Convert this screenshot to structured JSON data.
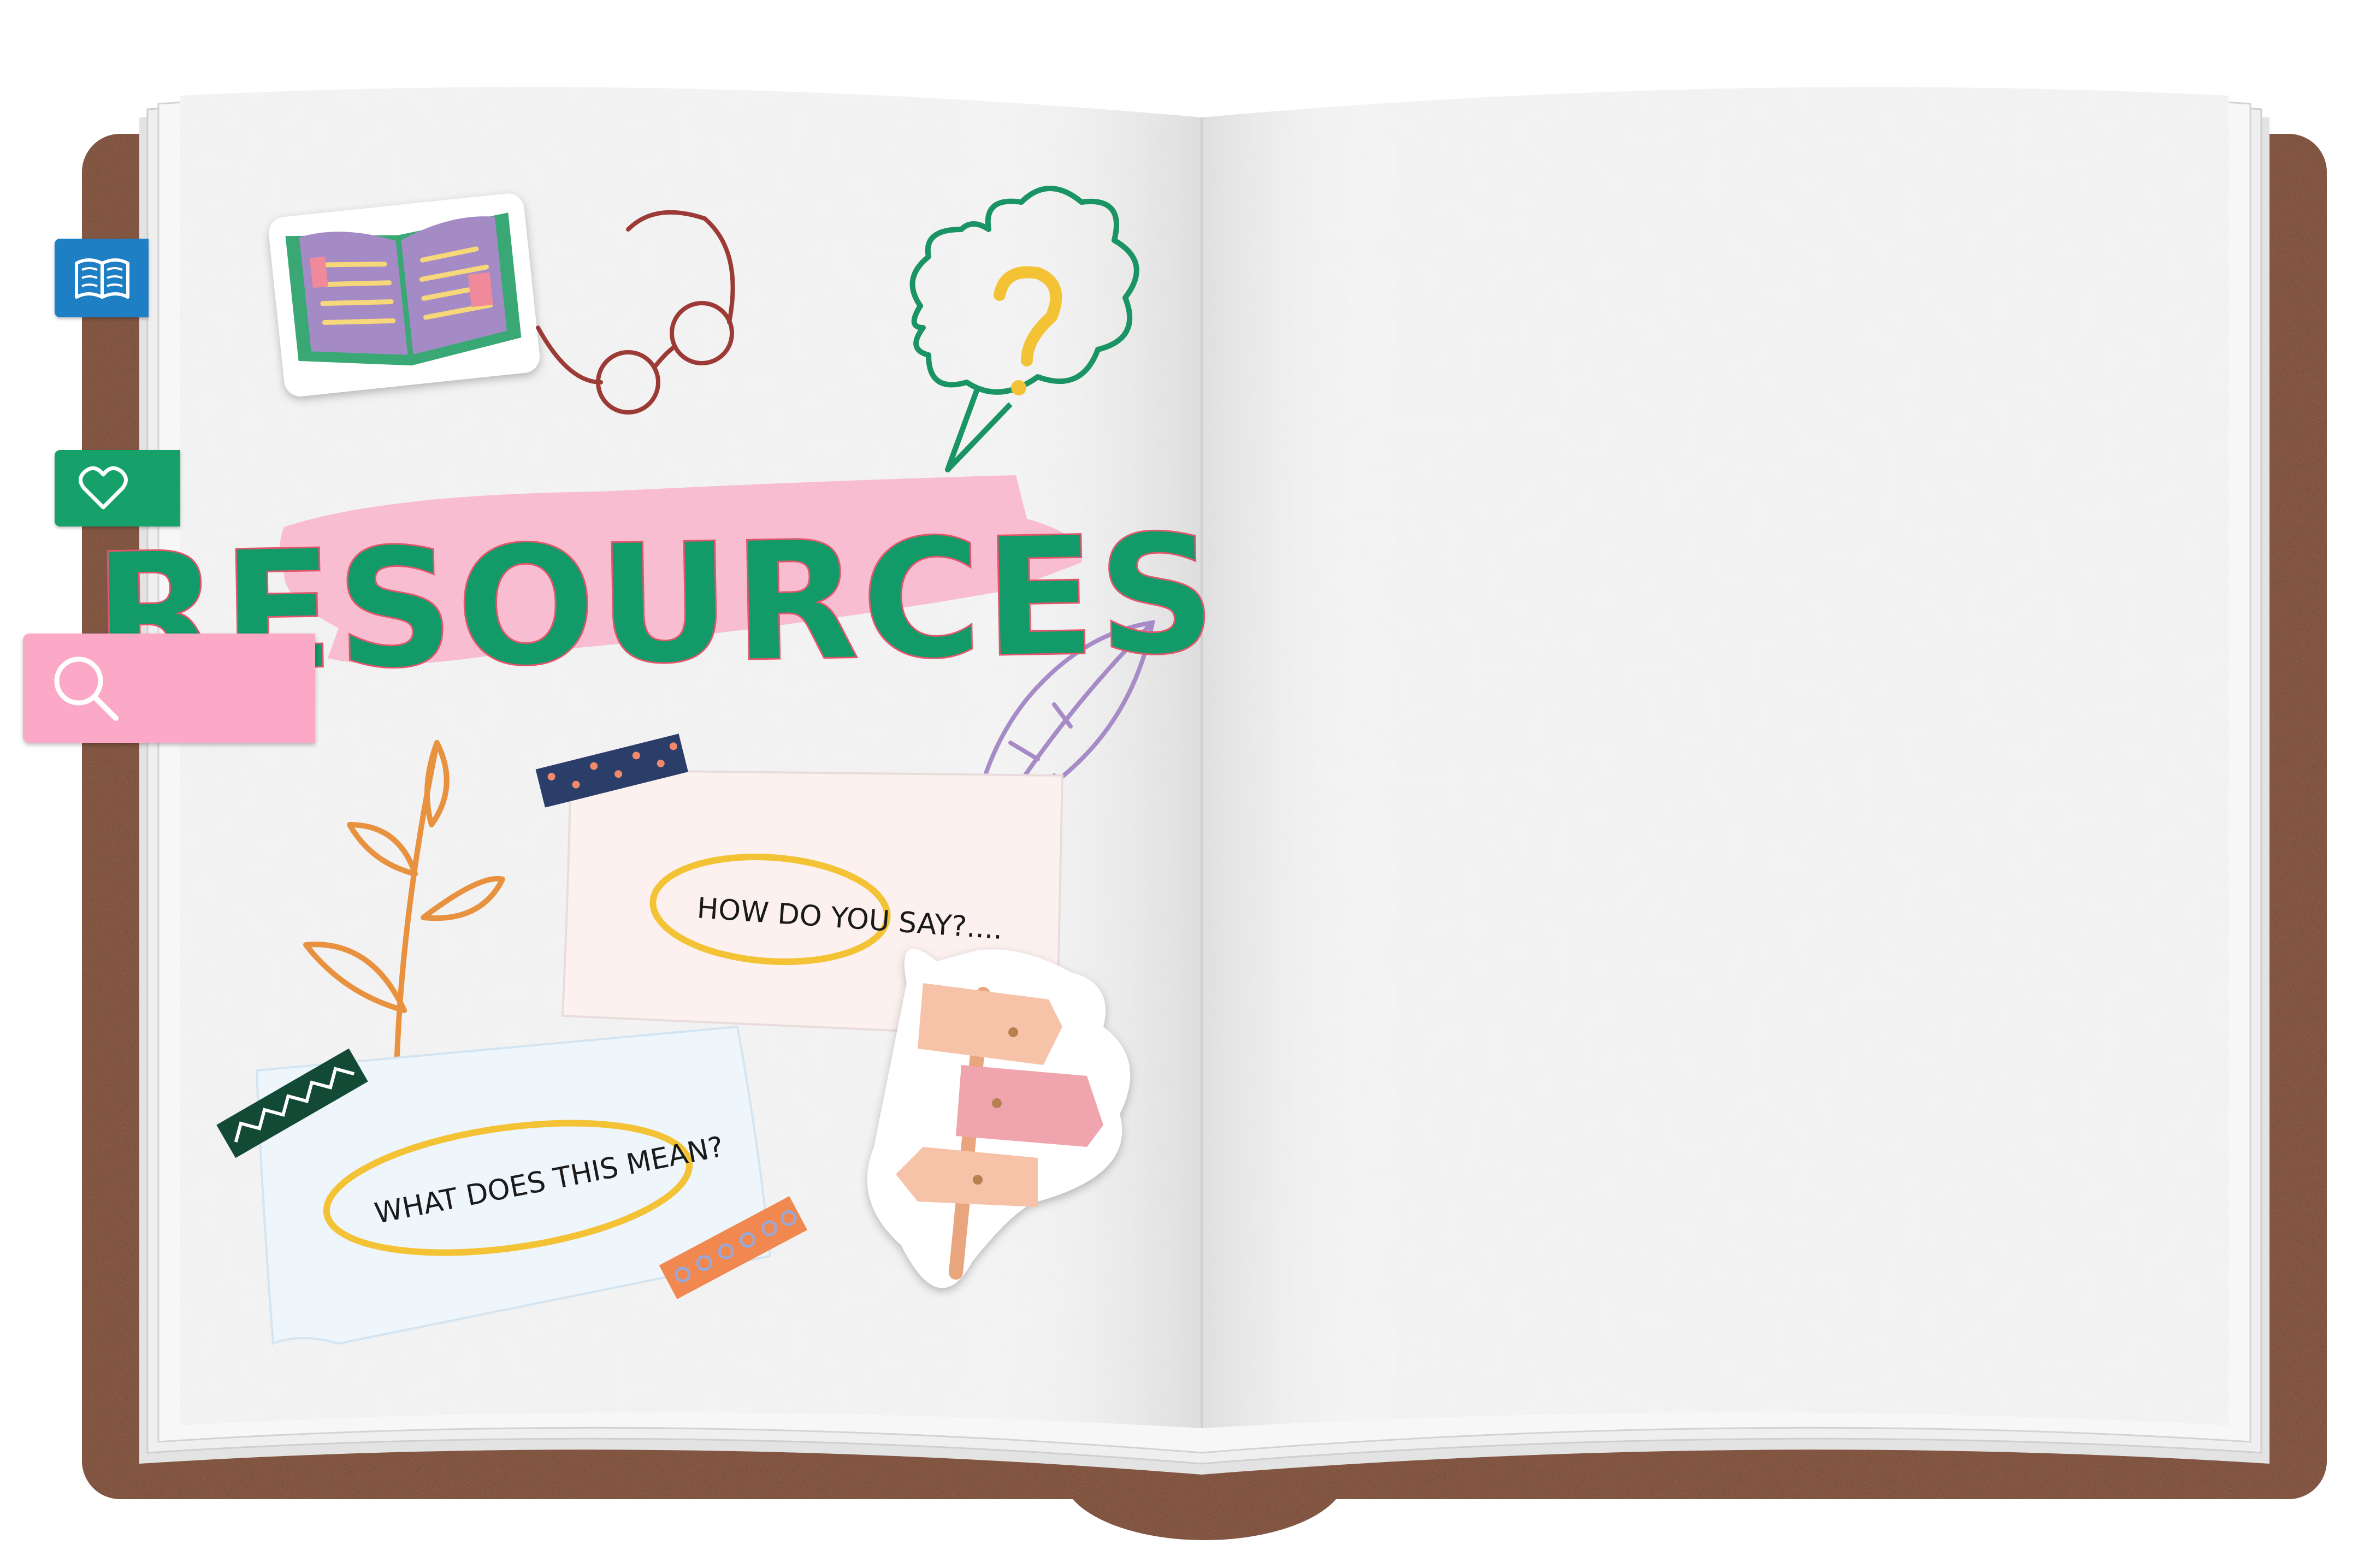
{
  "page": {
    "title": "RESOURCES",
    "note_1": "HOW DO YOU SAY?....",
    "note_2": "WHAT DOES THIS MEAN?"
  },
  "tabs": {
    "bookmarks_icon": "open-book-icon",
    "favorites_icon": "heart-icon",
    "search_icon": "search-icon"
  },
  "search": {
    "value": "",
    "placeholder": ""
  },
  "colors": {
    "cover": "#6b3f2c",
    "page": "#f5f5f5",
    "title": "#129a68",
    "highlight": "#f9bdd1",
    "bookmark_tab": "#1f7fc4",
    "favorites_tab": "#16a06a",
    "search_tab": "#fca9c7",
    "circle_ink": "#f3c235"
  }
}
